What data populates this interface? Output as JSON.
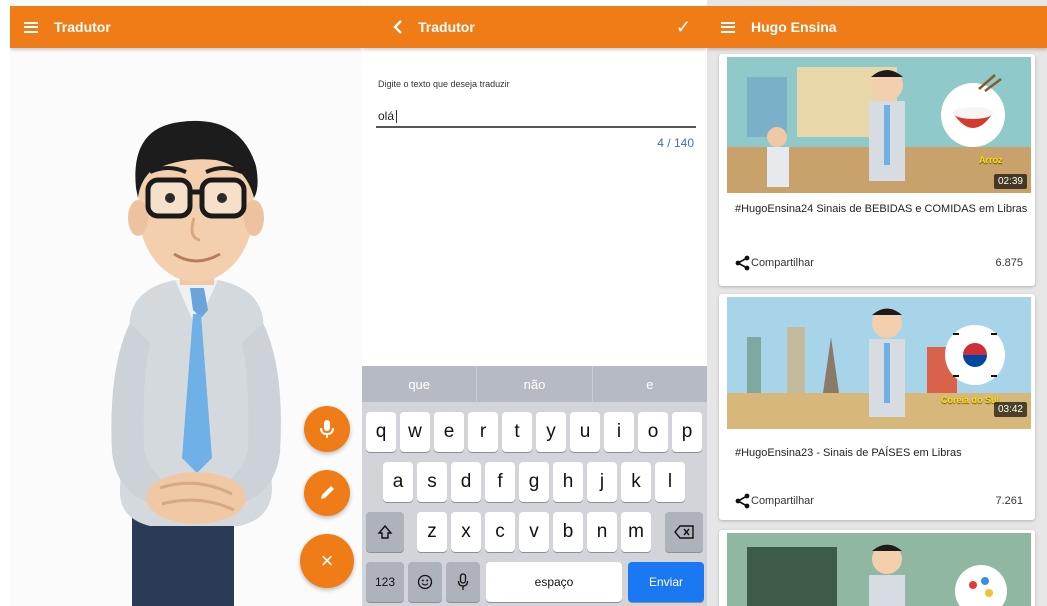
{
  "colors": {
    "accent": "#ef7c16",
    "send_key": "#1a79f2",
    "counter": "#3c6ec8"
  },
  "translator_panel": {
    "title": "Tradutor",
    "fabs": [
      {
        "icon": "microphone-icon"
      },
      {
        "icon": "pencil-icon"
      },
      {
        "icon": "close-icon",
        "label": "×"
      }
    ]
  },
  "input_panel": {
    "title": "Tradutor",
    "confirm_icon": "✓",
    "prompt": "Digite o texto que deseja traduzir",
    "input_value": "olá",
    "counter": "4 / 140",
    "keyboard": {
      "suggestions": [
        "que",
        "não",
        "e"
      ],
      "row1": [
        "q",
        "w",
        "e",
        "r",
        "t",
        "y",
        "u",
        "i",
        "o",
        "p"
      ],
      "row2": [
        "a",
        "s",
        "d",
        "f",
        "g",
        "h",
        "j",
        "k",
        "l"
      ],
      "row3": [
        "z",
        "x",
        "c",
        "v",
        "b",
        "n",
        "m"
      ],
      "numbers_key": "123",
      "space_key": "espaço",
      "send_key": "Enviar"
    }
  },
  "videos_panel": {
    "title": "Hugo Ensina",
    "videos": [
      {
        "title": "#HugoEnsina24 Sinais de BEBIDAS e COMIDAS em Libras",
        "thumb_label": "Arroz",
        "duration": "02:39",
        "share": "Compartilhar",
        "views": "6.875"
      },
      {
        "title": "#HugoEnsina23 - Sinais de PAÍSES em Libras",
        "thumb_label": "Coreia do Sul",
        "duration": "03:42",
        "share": "Compartilhar",
        "views": "7.261"
      },
      {
        "title": "",
        "thumb_label": "",
        "duration": "",
        "share": "",
        "views": ""
      }
    ]
  }
}
